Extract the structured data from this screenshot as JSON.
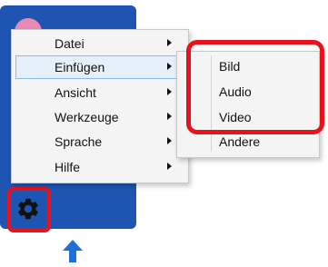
{
  "menu": {
    "items": [
      {
        "label": "Datei",
        "has_submenu": true,
        "active": false
      },
      {
        "label": "Einfügen",
        "has_submenu": true,
        "active": true
      },
      {
        "label": "Ansicht",
        "has_submenu": true,
        "active": false
      },
      {
        "label": "Werkzeuge",
        "has_submenu": true,
        "active": false
      },
      {
        "label": "Sprache",
        "has_submenu": true,
        "active": false
      },
      {
        "label": "Hilfe",
        "has_submenu": true,
        "active": false
      }
    ]
  },
  "submenu": {
    "items": [
      {
        "label": "Bild"
      },
      {
        "label": "Audio"
      },
      {
        "label": "Video"
      },
      {
        "label": "Andere"
      }
    ]
  },
  "icons": {
    "settings": "gear-icon",
    "arrow": "arrow-up-icon"
  },
  "colors": {
    "panel": "#1f55b2",
    "highlight": "#e8121b",
    "active_item_bg": "#e5f0fb",
    "active_item_border": "#8dbce8",
    "arrow": "#1e6fd9"
  }
}
